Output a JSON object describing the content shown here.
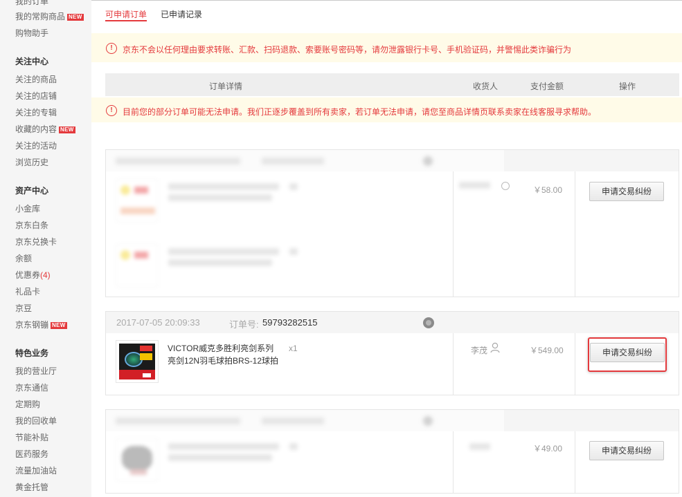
{
  "sidebar": {
    "top_cut": "我的订单",
    "top_items": [
      {
        "label": "我的常购商品",
        "badge": "NEW"
      },
      {
        "label": "购物助手"
      }
    ],
    "sections": [
      {
        "title": "关注中心",
        "items": [
          {
            "label": "关注的商品"
          },
          {
            "label": "关注的店铺"
          },
          {
            "label": "关注的专辑"
          },
          {
            "label": "收藏的内容",
            "badge": "NEW"
          },
          {
            "label": "关注的活动"
          },
          {
            "label": "浏览历史"
          }
        ]
      },
      {
        "title": "资产中心",
        "items": [
          {
            "label": "小金库"
          },
          {
            "label": "京东白条"
          },
          {
            "label": "京东兑换卡"
          },
          {
            "label": "余额"
          },
          {
            "label": "优惠券",
            "count": "(4)"
          },
          {
            "label": "礼品卡"
          },
          {
            "label": "京豆"
          },
          {
            "label": "京东钢镚",
            "badge": "NEW"
          }
        ]
      },
      {
        "title": "特色业务",
        "items": [
          {
            "label": "我的营业厅"
          },
          {
            "label": "京东通信"
          },
          {
            "label": "定期购"
          },
          {
            "label": "我的回收单"
          },
          {
            "label": "节能补贴"
          },
          {
            "label": "医药服务"
          },
          {
            "label": "流量加油站"
          },
          {
            "label": "黄金托管"
          }
        ]
      }
    ]
  },
  "tabs": [
    {
      "label": "可申请订单",
      "active": true
    },
    {
      "label": "已申请记录",
      "active": false
    }
  ],
  "notices": {
    "warning_icon": "!",
    "fraud": "京东不会以任何理由要求转账、汇款、扫码退款、索要账号密码等，请勿泄露银行卡号、手机验证码，并警惕此类诈骗行为",
    "partial": "目前您的部分订单可能无法申请。我们正逐步覆盖到所有卖家，若订单无法申请，请您至商品详情页联系卖家在线客服寻求帮助。"
  },
  "table_header": {
    "details": "订单详情",
    "consignee": "收货人",
    "amount": "支付金额",
    "action": "操作"
  },
  "orders": [
    {
      "blurred": true,
      "price": "￥58.00",
      "action_label": "申请交易纠纷"
    },
    {
      "blurred": false,
      "date": "2017-07-05 20:09:33",
      "order_no_label": "订单号:",
      "order_no": "59793282515",
      "product_line1": "VICTOR威克多胜利亮剑系列",
      "product_line2": "亮剑12N羽毛球拍BRS-12球拍",
      "qty": "x1",
      "consignee": "李茂",
      "price": "￥549.00",
      "action_label": "申请交易纠纷",
      "focused": true
    },
    {
      "blurred": true,
      "price": "￥49.00",
      "action_label": "申请交易纠纷"
    }
  ],
  "colors": {
    "accent": "#e4393c",
    "notice_bg": "#fffbe8",
    "sidebar_bg": "#f5f5f5"
  },
  "icons": {
    "warning": "warning-circle-icon",
    "user": "user-icon",
    "shop": "shop-icon",
    "search": "search-icon"
  }
}
